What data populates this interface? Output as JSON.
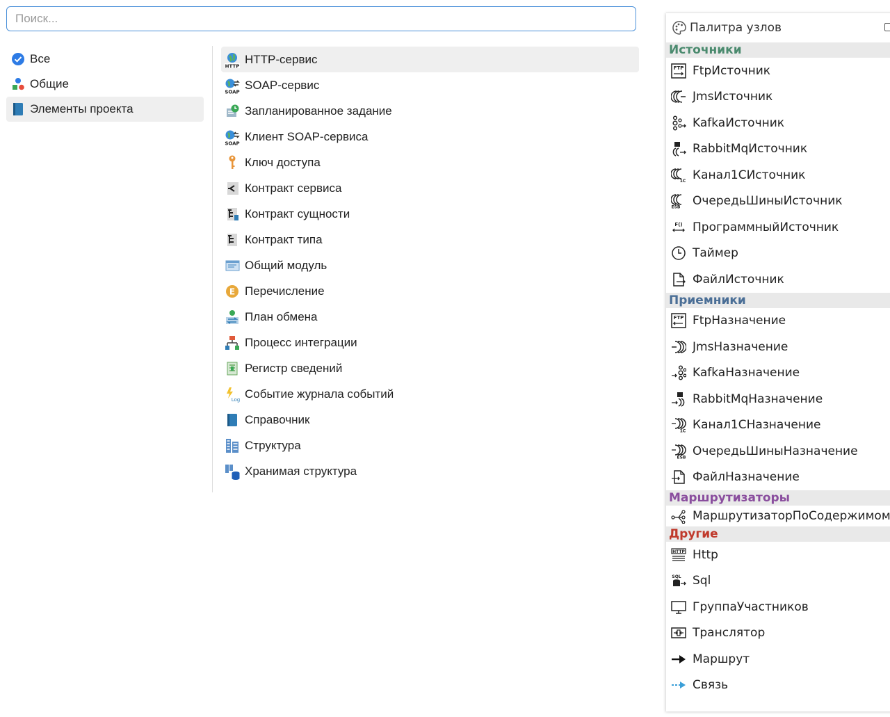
{
  "search": {
    "placeholder": "Поиск...",
    "value": ""
  },
  "categories": [
    {
      "label": "Все",
      "icon": "check-circle-icon"
    },
    {
      "label": "Общие",
      "icon": "shapes-icon"
    },
    {
      "label": "Элементы проекта",
      "icon": "book-icon"
    }
  ],
  "items": [
    {
      "label": "HTTP-сервис",
      "icon": "http-service-icon"
    },
    {
      "label": "SOAP-сервис",
      "icon": "soap-service-icon"
    },
    {
      "label": "Запланированное задание",
      "icon": "scheduled-job-icon"
    },
    {
      "label": "Клиент SOAP-сервиса",
      "icon": "soap-client-icon"
    },
    {
      "label": "Ключ доступа",
      "icon": "key-icon"
    },
    {
      "label": "Контракт сервиса",
      "icon": "service-contract-icon"
    },
    {
      "label": "Контракт сущности",
      "icon": "entity-contract-icon"
    },
    {
      "label": "Контракт типа",
      "icon": "type-contract-icon"
    },
    {
      "label": "Общий модуль",
      "icon": "common-module-icon"
    },
    {
      "label": "Перечисление",
      "icon": "enum-icon"
    },
    {
      "label": "План обмена",
      "icon": "exchange-plan-icon"
    },
    {
      "label": "Процесс интеграции",
      "icon": "integration-process-icon"
    },
    {
      "label": "Регистр сведений",
      "icon": "info-register-icon"
    },
    {
      "label": "Событие журнала событий",
      "icon": "log-event-icon"
    },
    {
      "label": "Справочник",
      "icon": "catalog-icon"
    },
    {
      "label": "Структура",
      "icon": "structure-icon"
    },
    {
      "label": "Хранимая структура",
      "icon": "stored-structure-icon"
    }
  ],
  "palette": {
    "title": "Палитра узлов",
    "sections": [
      {
        "label": "Источники",
        "color": "#4a8a6e",
        "items": [
          {
            "label": "FtpИсточник",
            "icon": "ftp-icon"
          },
          {
            "label": "JmsИсточник",
            "icon": "jms-source-icon"
          },
          {
            "label": "KafkaИсточник",
            "icon": "kafka-source-icon"
          },
          {
            "label": "RabbitMqИсточник",
            "icon": "rabbitmq-source-icon"
          },
          {
            "label": "Канал1СИсточник",
            "icon": "channel-1c-source-icon"
          },
          {
            "label": "ОчередьШиныИсточник",
            "icon": "esb-queue-source-icon"
          },
          {
            "label": "ПрограммныйИсточник",
            "icon": "program-source-icon"
          },
          {
            "label": "Таймер",
            "icon": "timer-icon"
          },
          {
            "label": "ФайлИсточник",
            "icon": "file-source-icon"
          }
        ]
      },
      {
        "label": "Приемники",
        "color": "#4a6e96",
        "items": [
          {
            "label": "FtpНазначение",
            "icon": "ftp-icon"
          },
          {
            "label": "JmsНазначение",
            "icon": "jms-dest-icon"
          },
          {
            "label": "KafkaНазначение",
            "icon": "kafka-dest-icon"
          },
          {
            "label": "RabbitMqНазначение",
            "icon": "rabbitmq-dest-icon"
          },
          {
            "label": "Канал1СНазначение",
            "icon": "channel-1c-dest-icon"
          },
          {
            "label": "ОчередьШиныНазначение",
            "icon": "esb-queue-dest-icon"
          },
          {
            "label": "ФайлНазначение",
            "icon": "file-dest-icon"
          }
        ]
      },
      {
        "label": "Маршрутизаторы",
        "color": "#8a4e9e",
        "items": [
          {
            "label": "МаршрутизаторПоСодержимому",
            "icon": "content-router-icon"
          }
        ]
      },
      {
        "label": "Другие",
        "color": "#c0392b",
        "items": [
          {
            "label": "Http",
            "icon": "http-icon"
          },
          {
            "label": "Sql",
            "icon": "sql-icon"
          },
          {
            "label": "ГруппаУчастников",
            "icon": "participants-group-icon"
          },
          {
            "label": "Транслятор",
            "icon": "translator-icon"
          },
          {
            "label": "Маршрут",
            "icon": "route-arrow-icon"
          },
          {
            "label": "Связь",
            "icon": "link-arrow-icon"
          }
        ]
      }
    ]
  }
}
